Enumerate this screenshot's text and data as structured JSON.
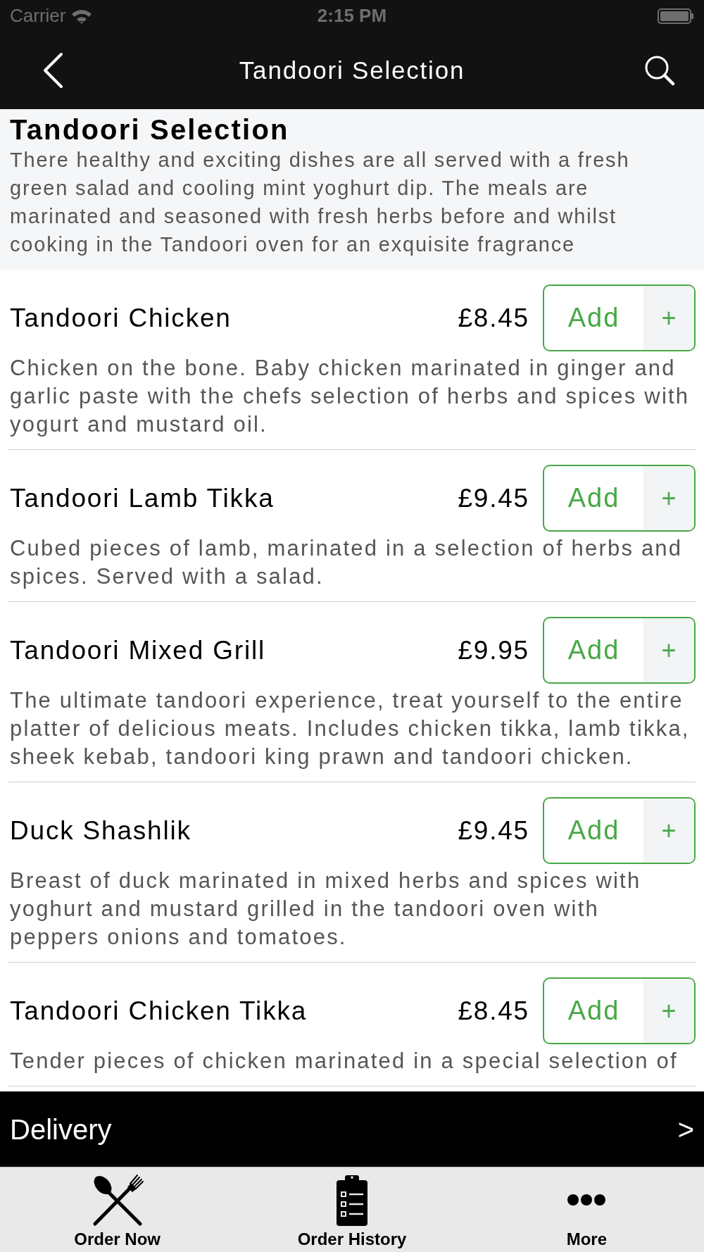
{
  "status_bar": {
    "carrier": "Carrier",
    "time": "2:15 PM"
  },
  "nav_bar": {
    "title": "Tandoori Selection"
  },
  "category": {
    "title": "Tandoori Selection",
    "description": "There healthy and exciting dishes are all served with a fresh green salad and cooling mint yoghurt dip. The meals are marinated and seasoned with fresh herbs before and whilst cooking in the Tandoori oven for an exquisite fragrance"
  },
  "menu_items": [
    {
      "name": "Tandoori Chicken",
      "price": "£8.45",
      "button_label": "Add",
      "plus_label": "+",
      "description": "Chicken on the bone. Baby chicken marinated in ginger and garlic paste with the chefs selection of herbs and spices with yogurt and mustard oil."
    },
    {
      "name": "Tandoori Lamb Tikka",
      "price": "£9.45",
      "button_label": "Add",
      "plus_label": "+",
      "description": "Cubed pieces of lamb, marinated in a selection of herbs and spices. Served with a salad."
    },
    {
      "name": "Tandoori Mixed Grill",
      "price": "£9.95",
      "button_label": "Add",
      "plus_label": "+",
      "description": "The ultimate tandoori experience, treat yourself to the entire platter of delicious meats. Includes chicken tikka, lamb tikka, sheek kebab, tandoori king prawn and tandoori chicken."
    },
    {
      "name": "Duck Shashlik",
      "price": "£9.45",
      "button_label": "Add",
      "plus_label": "+",
      "description": "Breast of duck marinated in mixed herbs and spices with yoghurt and mustard grilled in the tandoori oven with peppers onions and tomatoes."
    },
    {
      "name": "Tandoori Chicken Tikka",
      "price": "£8.45",
      "button_label": "Add",
      "plus_label": "+",
      "description": "Tender pieces of chicken marinated in a special selection of"
    }
  ],
  "delivery_bar": {
    "label": "Delivery",
    "arrow": ">"
  },
  "tab_bar": [
    {
      "label": "Order Now"
    },
    {
      "label": "Order History"
    },
    {
      "label": "More"
    }
  ]
}
